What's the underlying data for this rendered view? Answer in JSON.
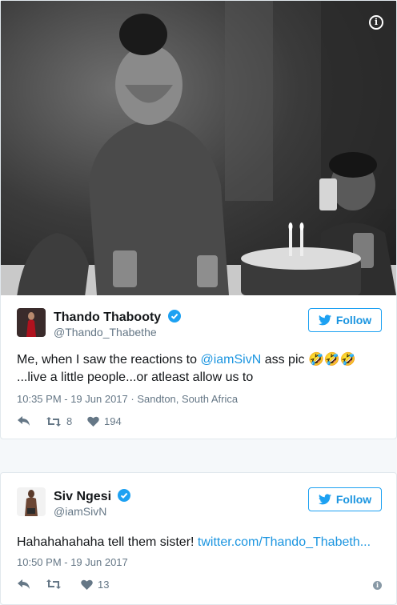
{
  "tweet1": {
    "name": "Thando Thabooty",
    "handle": "@Thando_Thabethe",
    "follow_label": "Follow",
    "text_part1": "Me, when I saw the reactions to ",
    "mention": "@iamSivN",
    "text_part2": " ass pic ",
    "emoji": "🤣🤣🤣",
    "text_line2": "...live a little people...or atleast allow us to",
    "timestamp": "10:35 PM - 19 Jun 2017",
    "separator": "·",
    "location": "Sandton, South Africa",
    "retweets": "8",
    "likes": "194",
    "photo_icon": "info-icon"
  },
  "tweet2": {
    "name": "Siv Ngesi",
    "handle": "@iamSivN",
    "follow_label": "Follow",
    "text_plain": "Hahahahahaha tell them sister! ",
    "link": "twitter.com/Thando_Thabeth...",
    "timestamp": "10:50 PM - 19 Jun 2017",
    "likes": "13"
  },
  "colors": {
    "accent": "#1da1f2",
    "link": "#1b95e0",
    "muted": "#657786",
    "background": "#f5f8fa"
  }
}
